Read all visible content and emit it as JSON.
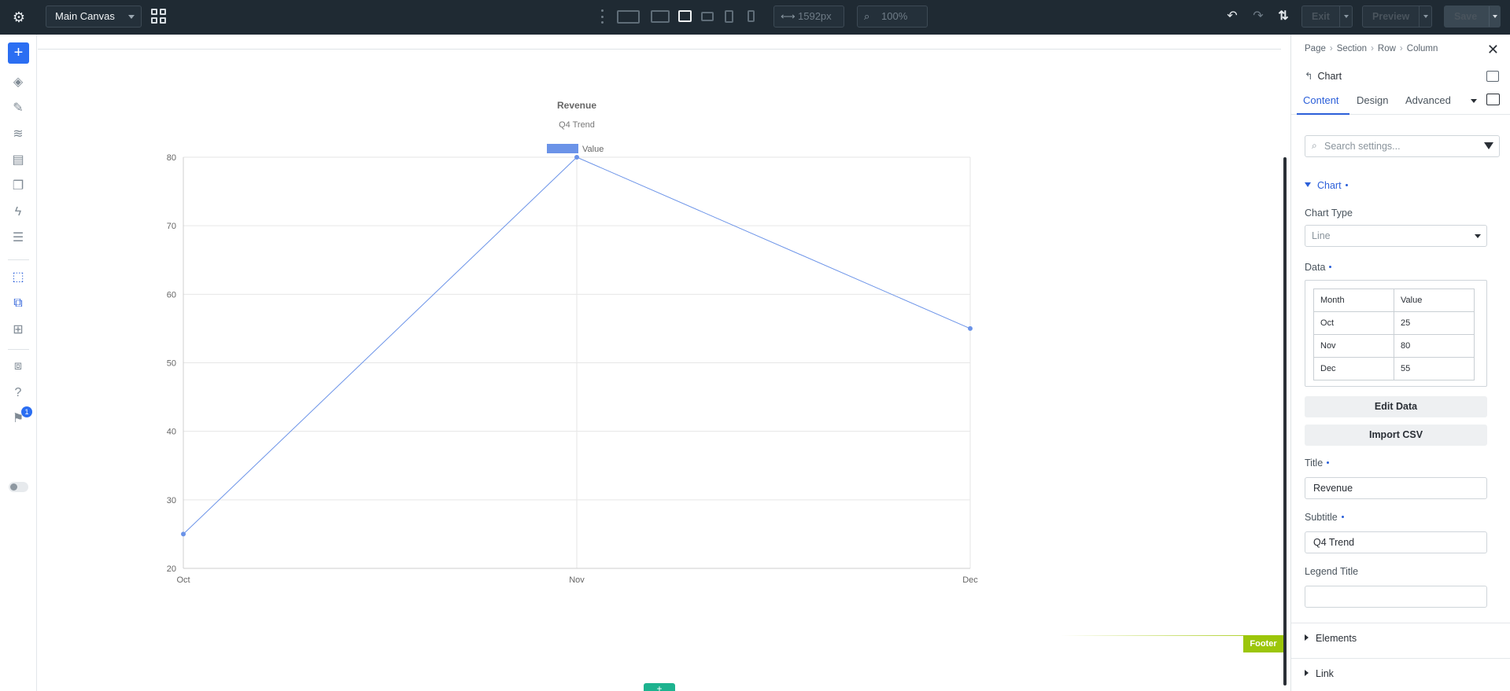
{
  "topbar": {
    "canvas_name": "Main Canvas",
    "width_value": "1592px",
    "zoom_value": "100%",
    "exit_label": "Exit",
    "preview_label": "Preview",
    "save_label": "Save"
  },
  "rail": {
    "notification_count": "1"
  },
  "canvas": {
    "footer_label": "Footer",
    "add_label": "+"
  },
  "panel": {
    "breadcrumbs": [
      "Page",
      "Section",
      "Row",
      "Column"
    ],
    "element_name": "Chart",
    "tabs": [
      "Content",
      "Design",
      "Advanced"
    ],
    "search_placeholder": "Search settings...",
    "chart_section": "Chart",
    "chart_type_label": "Chart Type",
    "chart_type_value": "Line",
    "data_label": "Data",
    "table_header": [
      "Month",
      "Value"
    ],
    "table_rows": [
      [
        "Oct",
        "25"
      ],
      [
        "Nov",
        "80"
      ],
      [
        "Dec",
        "55"
      ]
    ],
    "edit_data_label": "Edit Data",
    "import_csv_label": "Import CSV",
    "title_label": "Title",
    "title_value": "Revenue",
    "subtitle_label": "Subtitle",
    "subtitle_value": "Q4 Trend",
    "legend_title_label": "Legend Title",
    "legend_title_value": "",
    "elements_label": "Elements",
    "link_label": "Link"
  },
  "colors": {
    "accent": "#2b6ef2",
    "series": "#6b93e8",
    "footer": "#9cc60a"
  },
  "chart_data": {
    "type": "line",
    "title": "Revenue",
    "subtitle": "Q4 Trend",
    "categories": [
      "Oct",
      "Nov",
      "Dec"
    ],
    "series": [
      {
        "name": "Value",
        "values": [
          25,
          80,
          55
        ]
      }
    ],
    "yticks": [
      "20",
      "30",
      "40",
      "50",
      "60",
      "70",
      "80"
    ],
    "ylim": [
      20,
      80
    ],
    "grid": true,
    "legend_position": "top-center"
  }
}
